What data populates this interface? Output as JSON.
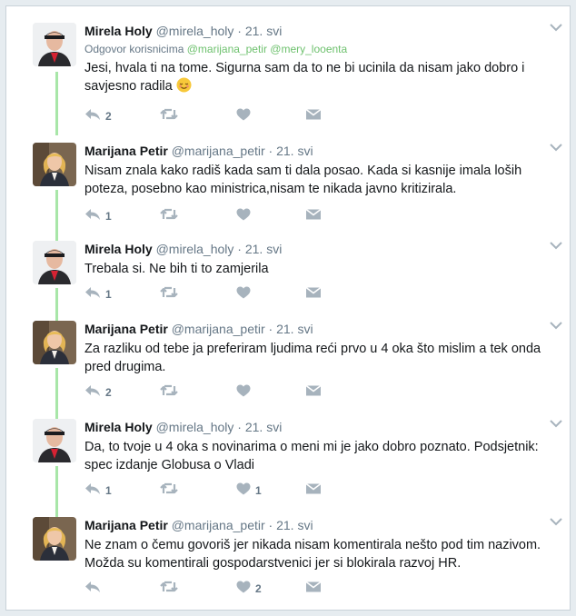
{
  "tweets": [
    {
      "name": "Mirela Holy",
      "handle": "@mirela_holy",
      "separator": "·",
      "time": "21. svi",
      "reply_context": {
        "prefix": "Odgovor korisnicima",
        "mentions": [
          "@marijana_petir",
          "@mery_looenta"
        ]
      },
      "text": "Jesi, hvala ti na tome. Sigurna sam da to ne bi ucinila da nisam jako dobro i savjesno radila",
      "emoji": "relieved-face",
      "reply_count": "2",
      "retweet_count": "",
      "like_count": "",
      "avatar": "mirela-avatar"
    },
    {
      "name": "Marijana Petir",
      "handle": "@marijana_petir",
      "separator": "·",
      "time": "21. svi",
      "text": "Nisam znala kako radiš kada sam ti dala posao. Kada si kasnije imala loših poteza, posebno kao ministrica,nisam te nikada javno kritizirala.",
      "reply_count": "1",
      "retweet_count": "",
      "like_count": "",
      "avatar": "marijana-avatar"
    },
    {
      "name": "Mirela Holy",
      "handle": "@mirela_holy",
      "separator": "·",
      "time": "21. svi",
      "text": "Trebala si. Ne bih ti to zamjerila",
      "reply_count": "1",
      "retweet_count": "",
      "like_count": "",
      "avatar": "mirela-avatar"
    },
    {
      "name": "Marijana Petir",
      "handle": "@marijana_petir",
      "separator": "·",
      "time": "21. svi",
      "text": "Za razliku od tebe ja preferiram ljudima reći prvo u 4 oka što mislim a tek onda pred drugima.",
      "reply_count": "2",
      "retweet_count": "",
      "like_count": "",
      "avatar": "marijana-avatar"
    },
    {
      "name": "Mirela Holy",
      "handle": "@mirela_holy",
      "separator": "·",
      "time": "21. svi",
      "text": "Da, to tvoje u 4 oka s novinarima o meni mi je jako dobro poznato. Podsjetnik: spec izdanje Globusa o Vladi",
      "reply_count": "1",
      "retweet_count": "",
      "like_count": "1",
      "avatar": "mirela-avatar"
    },
    {
      "name": "Marijana Petir",
      "handle": "@marijana_petir",
      "separator": "·",
      "time": "21. svi",
      "text": "Ne znam o čemu govoriš jer nikada nisam komentirala nešto pod tim nazivom. Možda su komentirali gospodarstvenici jer si blokirala razvoj HR.",
      "reply_count": "",
      "retweet_count": "",
      "like_count": "2",
      "avatar": "marijana-avatar"
    }
  ],
  "colors": {
    "thread_line": "#a8e6a8",
    "icon": "#a7b3bd",
    "mention": "#6ec16e",
    "secondary_text": "#657786"
  },
  "icons": {
    "reply": "reply-icon",
    "retweet": "retweet-icon",
    "like": "heart-icon",
    "dm": "direct-message-icon",
    "caret": "chevron-down-icon"
  }
}
